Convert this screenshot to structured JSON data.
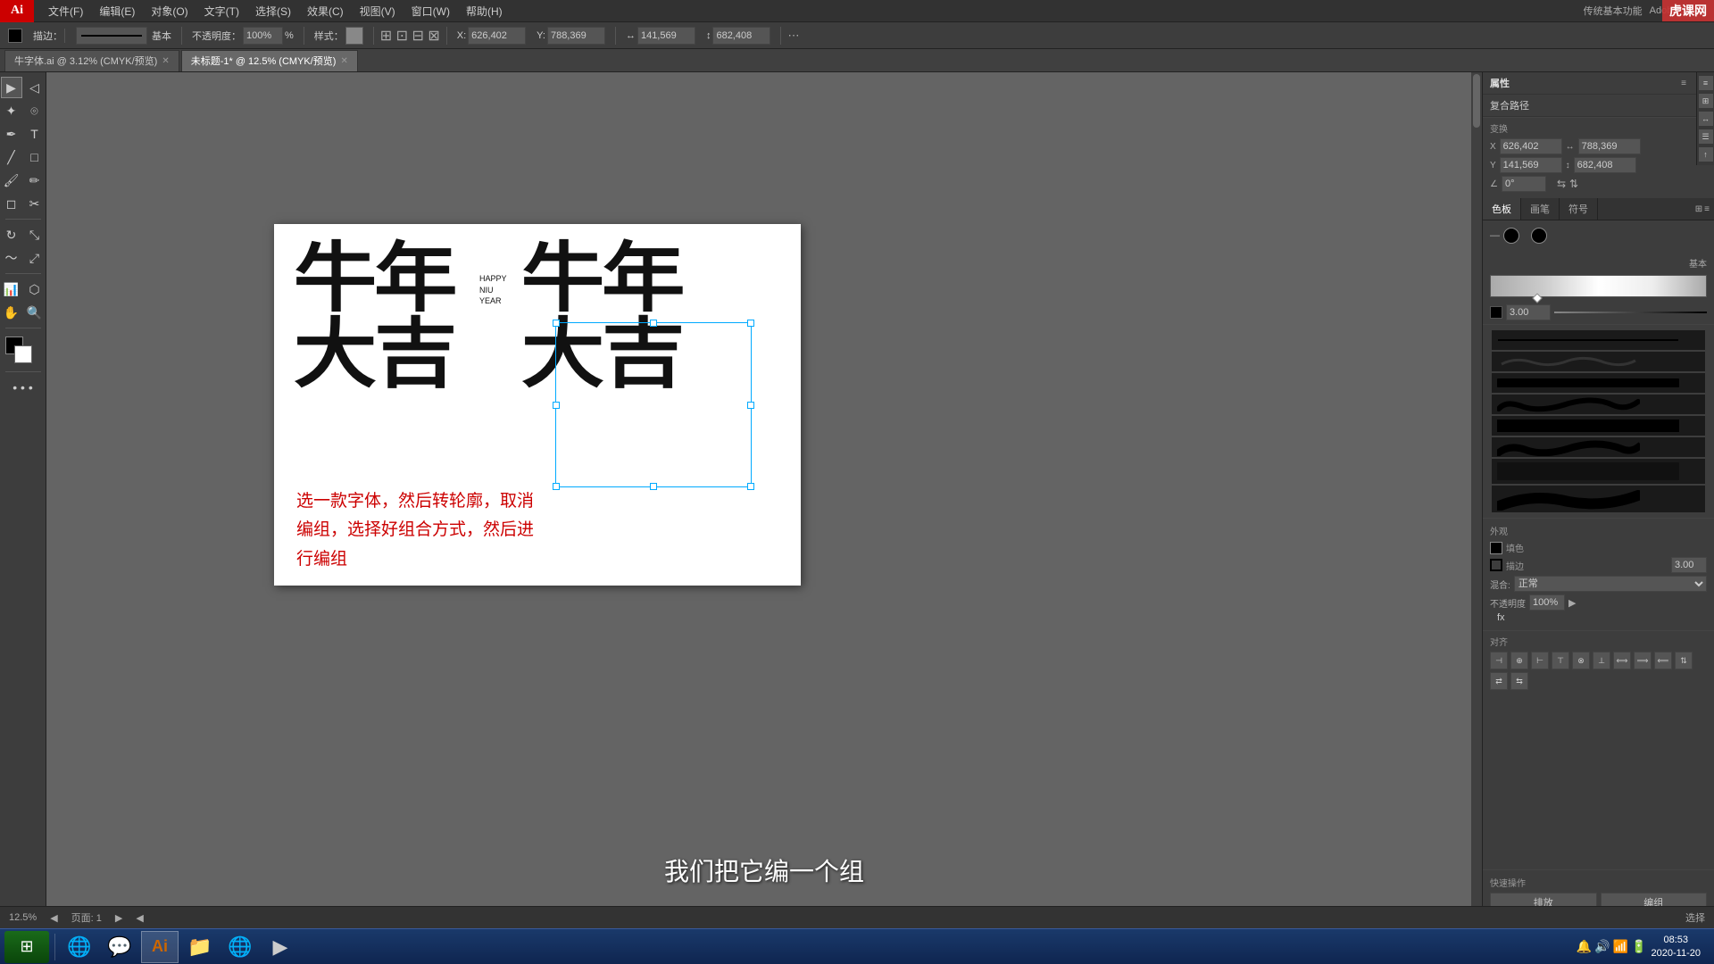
{
  "app": {
    "logo": "Ai",
    "title": "Adobe Illustrator",
    "top_right_label": "传统基本功能"
  },
  "menu": {
    "items": [
      "文件(F)",
      "编辑(E)",
      "对象(O)",
      "文字(T)",
      "选择(S)",
      "效果(C)",
      "视图(V)",
      "窗口(W)",
      "帮助(H)"
    ]
  },
  "toolbar": {
    "stroke_label": "描边：",
    "stroke_value": "基本",
    "opacity_label": "不透明度：",
    "opacity_value": "100%",
    "style_label": "样式：",
    "x_label": "X:",
    "x_value": "626,402",
    "y_label": "Y:",
    "y_value": "788,369",
    "w_label": "W:",
    "w_value": "141,569",
    "h_label": "H:",
    "h_value": "682,408"
  },
  "tabs": [
    {
      "label": "牛字体.ai @ 3.12% (CMYK/预览)",
      "active": false
    },
    {
      "label": "未标题-1* @ 12.5% (CMYK/预览)",
      "active": true
    }
  ],
  "canvas": {
    "zoom_level": "12.5%",
    "page_label": "页面: 1",
    "tool_label": "选择",
    "artboard": {
      "left_text": "牛年\n大吉",
      "right_text": "牛年\n大吉",
      "happy_line1": "HAPPY",
      "happy_line2": "NIU",
      "happy_line3": "YEAR",
      "red_text": "选一款字体，然后转轮廓，取消\n编组，选择好组合方式，然后进\n行编组"
    }
  },
  "right_panel": {
    "tabs": [
      "色板",
      "画笔",
      "符号"
    ],
    "property_label": "属性",
    "transform_label": "变换",
    "x_label": "X:",
    "x_value": "626,402",
    "y_label": "Y:",
    "y_value": "788,369",
    "w_symbol": "↔",
    "w_value": "141.569",
    "h_symbol": "↕",
    "h_value": "682,408",
    "angle_label": "∠ 0°",
    "appearance_label": "外观",
    "fill_label": "填色",
    "stroke_label": "描边",
    "stroke_value": "3.00",
    "opacity_label": "不透明度",
    "opacity_value": "100%",
    "align_label": "对齐",
    "shortcut_label": "快速操作",
    "shortcut_btn1": "排放",
    "shortcut_btn2": "编组"
  },
  "brushes": {
    "base_label": "基本",
    "category_label": "基本",
    "stroke_size": "3.00"
  },
  "subtitle": {
    "text": "我们把它编一个组"
  },
  "taskbar": {
    "clock": "08:53",
    "date": "2020-11-20",
    "apps": [
      "🪟",
      "💬",
      "🎨",
      "📁",
      "🌐",
      "🎵",
      "🎮"
    ]
  },
  "watermark": "虎课网"
}
